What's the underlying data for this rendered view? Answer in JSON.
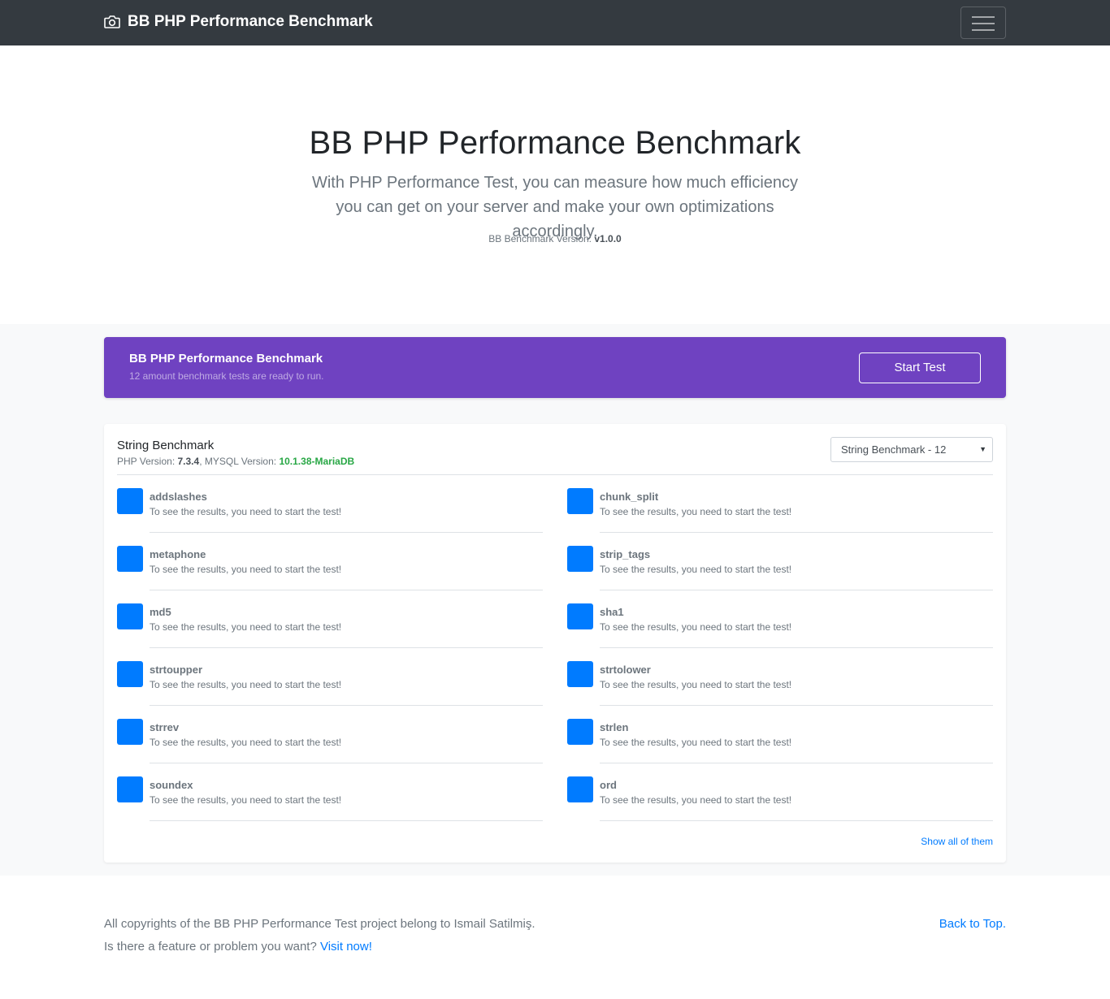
{
  "navbar": {
    "brand": "BB PHP Performance Benchmark",
    "brand_icon": "camera-icon",
    "menu_icon": "hamburger-icon"
  },
  "hero": {
    "title": "BB PHP Performance Benchmark",
    "lead": "With PHP Performance Test, you can measure how much efficiency you can get on your server and make your own optimizations accordingly.",
    "version_label": "BB Benchmark Version: ",
    "version_value": "v1.0.0"
  },
  "promo": {
    "title": "BB PHP Performance Benchmark",
    "subtitle": "12 amount benchmark tests are ready to run.",
    "button": "Start Test"
  },
  "card": {
    "title": "String Benchmark",
    "php_label": "PHP Version: ",
    "php_value": "7.3.4",
    "mysql_label": ", MYSQL Version: ",
    "mysql_value": "10.1.38-MariaDB",
    "select_value": "String Benchmark - 12",
    "items": [
      {
        "name": "addslashes",
        "message": "To see the results, you need to start the test!"
      },
      {
        "name": "chunk_split",
        "message": "To see the results, you need to start the test!"
      },
      {
        "name": "metaphone",
        "message": "To see the results, you need to start the test!"
      },
      {
        "name": "strip_tags",
        "message": "To see the results, you need to start the test!"
      },
      {
        "name": "md5",
        "message": "To see the results, you need to start the test!"
      },
      {
        "name": "sha1",
        "message": "To see the results, you need to start the test!"
      },
      {
        "name": "strtoupper",
        "message": "To see the results, you need to start the test!"
      },
      {
        "name": "strtolower",
        "message": "To see the results, you need to start the test!"
      },
      {
        "name": "strrev",
        "message": "To see the results, you need to start the test!"
      },
      {
        "name": "strlen",
        "message": "To see the results, you need to start the test!"
      },
      {
        "name": "soundex",
        "message": "To see the results, you need to start the test!"
      },
      {
        "name": "ord",
        "message": "To see the results, you need to start the test!"
      }
    ],
    "show_all": "Show all of them"
  },
  "footer": {
    "copyright": "All copyrights of the BB PHP Performance Test project belong to Ismail Satilmiş.",
    "feature_text": "Is there a feature or problem you want? ",
    "visit_link": "Visit now!",
    "back_to_top": "Back to Top."
  },
  "colors": {
    "navbar": "#343a40",
    "promo": "#6f42c1",
    "accent": "#007bff",
    "success": "#28a745"
  }
}
